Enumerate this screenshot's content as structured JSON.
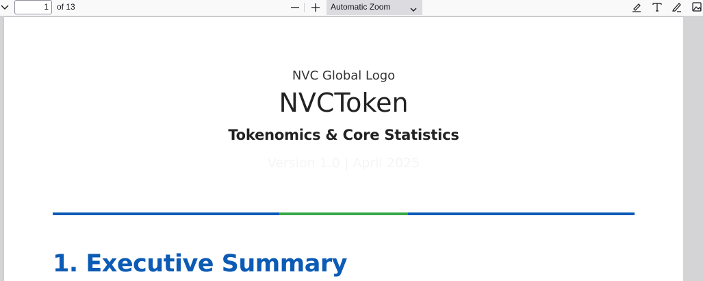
{
  "toolbar": {
    "page_number": "1",
    "page_count_label": "of 13",
    "zoom_label": "Automatic Zoom",
    "icons": [
      "chevron-down-icon",
      "minus-icon",
      "plus-icon",
      "highlight-icon",
      "text-icon",
      "draw-icon",
      "image-icon"
    ]
  },
  "document": {
    "logo_text": "NVC Global Logo",
    "title": "NVCToken",
    "subtitle": "Tokenomics & Core Statistics",
    "version": "Version 1.0 | April 2025",
    "section_heading": "1. Executive Summary"
  },
  "colors": {
    "brand_blue": "#0c5bb5",
    "accent_green": "#38a74a"
  }
}
